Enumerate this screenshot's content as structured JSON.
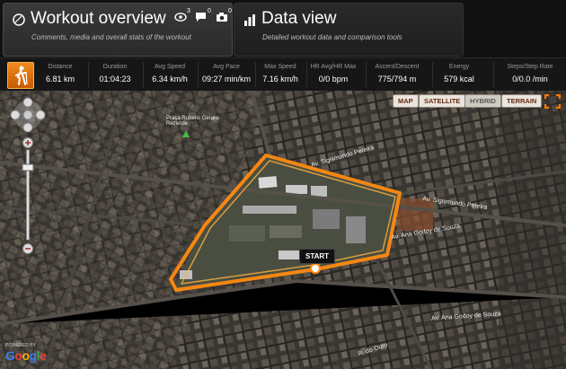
{
  "tabs": {
    "workout": {
      "title": "Workout overview",
      "subtitle": "Comments, media and overall stats of the workout"
    },
    "data": {
      "title": "Data view",
      "subtitle": "Detailed workout data and comparison tools"
    },
    "counters": {
      "views": "3",
      "comments": "0",
      "photos": "0"
    }
  },
  "stats": [
    {
      "label": "Distance",
      "value": "6.81 km"
    },
    {
      "label": "Duration",
      "value": "01:04:23"
    },
    {
      "label": "Avg Speed",
      "value": "6.34 km/h"
    },
    {
      "label": "Avg Pace",
      "value": "09:27 min/km"
    },
    {
      "label": "Max Speed",
      "value": "7.16 km/h"
    },
    {
      "label": "HR Avg/HR Max",
      "value": "0/0 bpm"
    },
    {
      "label": "Ascent/Descent",
      "value": "775/794 m"
    },
    {
      "label": "Energy",
      "value": "579 kcal"
    },
    {
      "label": "Steps/Step Rate",
      "value": "0/0.0 /min"
    }
  ],
  "map": {
    "types": [
      "MAP",
      "SATELLITE",
      "HYBRID",
      "TERRAIN"
    ],
    "start_label": "START",
    "powered_by": "POWERED BY",
    "google": "Google",
    "streets": [
      "Av. Sigismundo Pereira",
      "Av. Sigismundo Pereira",
      "Av. Ana Godoy de Souza",
      "Av. Ana Godoy de Souza",
      "R. do Ouro",
      "Praça Rubens Gerara Rezende"
    ]
  },
  "colors": {
    "accent": "#f07d00",
    "route": "#ff8a10"
  },
  "icons": {
    "sport": "hiker-icon",
    "views": "eye-icon",
    "comments": "speech-bubble-icon",
    "photos": "camera-icon"
  }
}
